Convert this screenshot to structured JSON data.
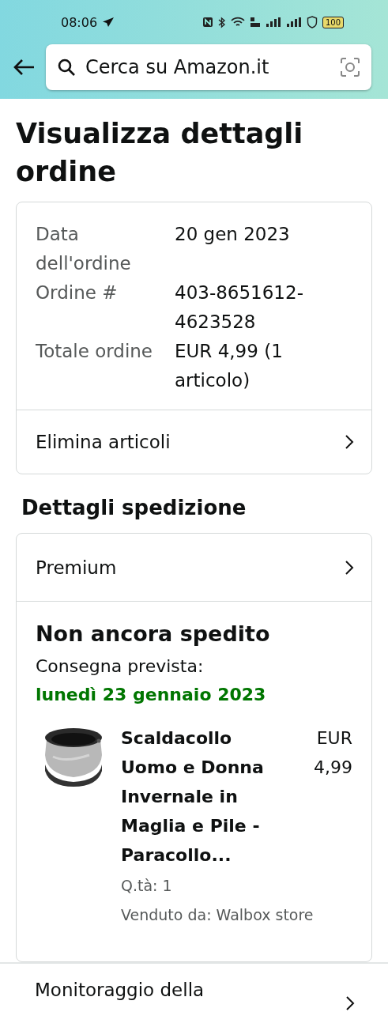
{
  "status_bar": {
    "time": "08:06",
    "battery": "100"
  },
  "search": {
    "placeholder": "Cerca su Amazon.it"
  },
  "title": "Visualizza dettagli ordine",
  "order_summary": {
    "fields": [
      {
        "label": "Data dell'ordine",
        "value": "20 gen 2023"
      },
      {
        "label": "Ordine #",
        "value": "403-8651612-4623528"
      },
      {
        "label": "Totale ordine",
        "value": "EUR 4,99 (1 articolo)"
      }
    ],
    "action": "Elimina articoli"
  },
  "shipping": {
    "heading": "Dettagli spedizione",
    "service": "Premium",
    "status": "Non ancora spedito",
    "delivery_label": "Consegna prevista:",
    "delivery_date": "lunedì 23 gennaio 2023",
    "item": {
      "kind": "picture",
      "name": "Scaldacollo Uomo e Donna Invernale in Maglia e Pile - Paracollo...",
      "price": "EUR 4,99",
      "quantity": "Q.tà: 1",
      "seller": "Venduto da: Walbox store"
    }
  },
  "tracking": {
    "label": "Monitoraggio della"
  }
}
